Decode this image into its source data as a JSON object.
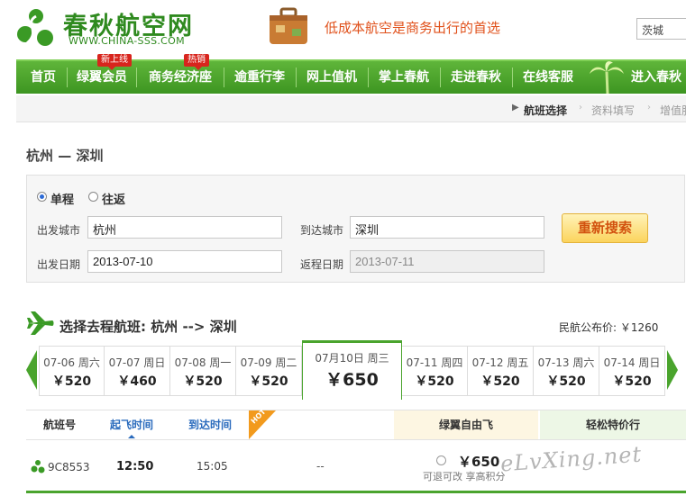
{
  "header": {
    "logo_cn": "春秋航空网",
    "logo_en": "WWW.CHINA-SSS.COM",
    "slogan": "低成本航空是商务出行的首选",
    "search_value": "茨城"
  },
  "nav": {
    "items": [
      "首页",
      "绿翼会员",
      "商务经济座",
      "逾重行李",
      "网上值机",
      "掌上春航",
      "走进春秋",
      "在线客服",
      "进入春秋"
    ],
    "badges": {
      "member": "新上线",
      "business": "热销"
    }
  },
  "steps": {
    "active": "航班选择",
    "step2": "资料填写",
    "step3": "增值服"
  },
  "route": {
    "title": "杭州 — 深圳"
  },
  "search": {
    "one_way_label": "单程",
    "round_trip_label": "往返",
    "depart_city_label": "出发城市",
    "depart_city_value": "杭州",
    "arrive_city_label": "到达城市",
    "arrive_city_value": "深圳",
    "depart_date_label": "出发日期",
    "depart_date_value": "2013-07-10",
    "return_date_label": "返程日期",
    "return_date_value": "2013-07-11",
    "research_button": "重新搜索"
  },
  "flights": {
    "title": "选择去程航班: 杭州 --> 深圳",
    "public_price": "民航公布价: ￥1260",
    "dates": [
      {
        "date": "07-06 周六",
        "price": "￥520"
      },
      {
        "date": "07-07 周日",
        "price": "￥460"
      },
      {
        "date": "07-08 周一",
        "price": "￥520"
      },
      {
        "date": "07-09 周二",
        "price": "￥520"
      },
      {
        "date": "07月10日 周三",
        "price": "￥650"
      },
      {
        "date": "07-11 周四",
        "price": "￥520"
      },
      {
        "date": "07-12 周五",
        "price": "￥520"
      },
      {
        "date": "07-13 周六",
        "price": "￥520"
      },
      {
        "date": "07-14 周日",
        "price": "￥520"
      }
    ],
    "columns": {
      "flight_no": "航班号",
      "depart_time": "起飞时间",
      "arrive_time": "到达时间",
      "business": "商务经济座",
      "green_free": "绿翼自由飞",
      "easy_special": "轻松特价行",
      "hot_tag": "HOT"
    },
    "rows": [
      {
        "flight_no": "9C8553",
        "depart": "12:50",
        "arrive": "15:05",
        "business": "--",
        "green_price": "￥650",
        "green_note": "可退可改 享高积分"
      }
    ]
  },
  "watermark": "eLvXing.net",
  "colors": {
    "brand_green": "#4aa42d",
    "accent_orange": "#e0501a",
    "link_blue": "#2a6bbd"
  }
}
